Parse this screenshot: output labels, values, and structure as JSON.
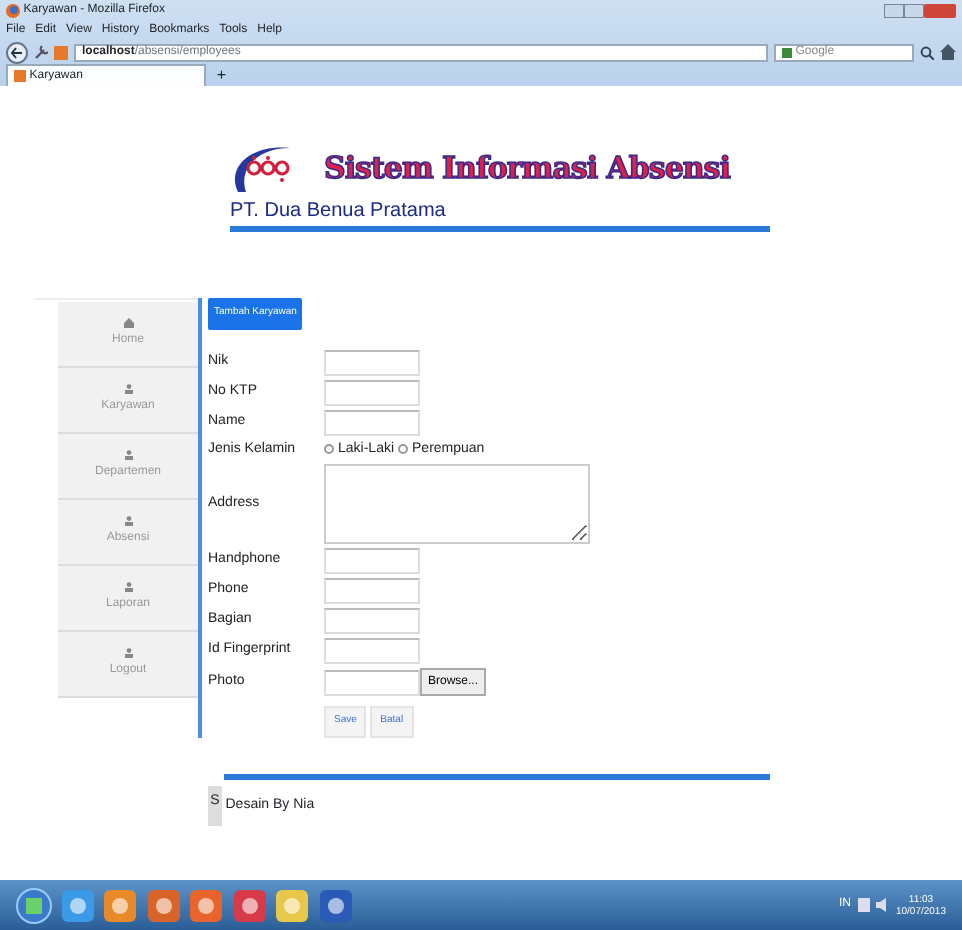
{
  "window": {
    "title": "Karyawan - Mozilla Firefox"
  },
  "menu": [
    {
      "label": "File"
    },
    {
      "label": "Edit"
    },
    {
      "label": "View"
    },
    {
      "label": "History"
    },
    {
      "label": "Bookmarks"
    },
    {
      "label": "Tools"
    },
    {
      "label": "Help"
    }
  ],
  "address_bar": {
    "url_host": "localhost",
    "url_path": "/absensi/employees"
  },
  "search": {
    "placeholder": "Google"
  },
  "tabs": [
    {
      "label": "Karyawan",
      "selected": true
    }
  ],
  "new_tab": "+",
  "header": {
    "title": "Sistem Informasi Absensi",
    "company": "PT. Dua Benua Pratama"
  },
  "sidebar": {
    "items": [
      {
        "label": "Home",
        "kind": "home"
      },
      {
        "label": "Karyawan",
        "kind": "user"
      },
      {
        "label": "Departemen",
        "kind": "user"
      },
      {
        "label": "Absensi",
        "kind": "user"
      },
      {
        "label": "Laporan",
        "kind": "user"
      },
      {
        "label": "Logout",
        "kind": "user"
      }
    ]
  },
  "add_button": "Tambah Karyawan",
  "form": {
    "fields": [
      {
        "label": "Nik",
        "kind": "text"
      },
      {
        "label": "No KTP",
        "kind": "text"
      },
      {
        "label": "Name",
        "kind": "text"
      },
      {
        "label": "Jenis Kelamin",
        "kind": "radio",
        "options": [
          {
            "label": "Laki-Laki",
            "selected": false
          },
          {
            "label": "Perempuan",
            "selected": false
          }
        ]
      },
      {
        "label": "Address",
        "kind": "textarea"
      },
      {
        "label": "Handphone",
        "kind": "text"
      },
      {
        "label": "Phone",
        "kind": "text"
      },
      {
        "label": "Bagian",
        "kind": "text"
      },
      {
        "label": "Id Fingerprint",
        "kind": "text"
      },
      {
        "label": "Photo",
        "kind": "file",
        "button": "Browse..."
      }
    ],
    "buttons": [
      {
        "label": "Save"
      },
      {
        "label": "Batal"
      }
    ]
  },
  "footer": {
    "side_tab": "S",
    "text": "Desain By Nia"
  },
  "taskbar": {
    "language": "IN",
    "time": "11:03",
    "date": "10/07/2013"
  }
}
